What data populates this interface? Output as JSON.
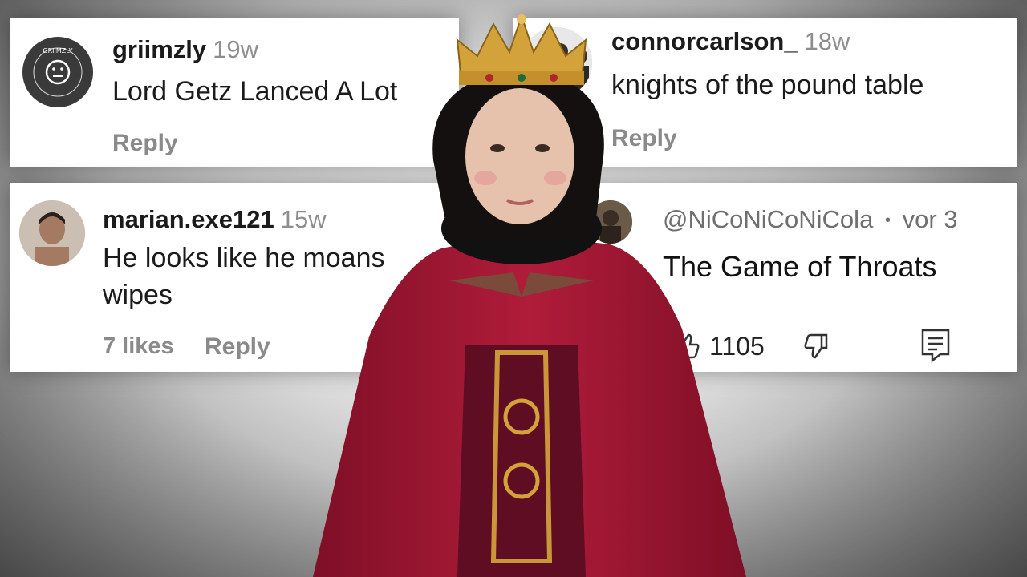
{
  "comments": [
    {
      "username": "griimzly",
      "time": "19w",
      "text": "Lord Getz Lanced A Lot",
      "reply_label": "Reply",
      "avatar_text": "GRIIMZLY"
    },
    {
      "username": "connorcarlson_",
      "time": "18w",
      "text": "knights of the pound table",
      "reply_label": "Reply"
    },
    {
      "username": "marian.exe121",
      "time": "15w",
      "text_line1": "He looks like he moans",
      "text_line2": "wipes",
      "likes_label": "7 likes",
      "reply_label": "Reply"
    }
  ],
  "yt_comment": {
    "username": "@NiCoNiCoNiCola",
    "separator": "•",
    "time": "vor 3",
    "text": "The Game of Throats",
    "like_count": "1105",
    "icons": [
      "thumbs-up-icon",
      "thumbs-down-icon",
      "reply-icon"
    ]
  },
  "colors": {
    "cloak": "#9e1733",
    "crown": "#d4a23a",
    "card": "#ffffff",
    "meta": "#8a8a8a"
  }
}
